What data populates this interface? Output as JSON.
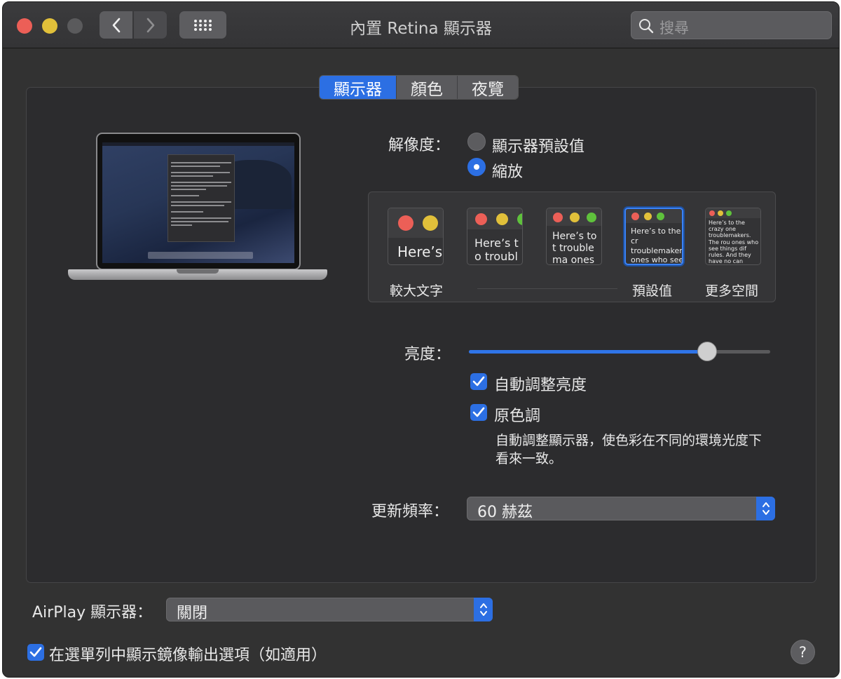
{
  "window": {
    "title": "內置 Retina 顯示器",
    "search_placeholder": "搜尋"
  },
  "tabs": [
    {
      "label": "顯示器",
      "active": true
    },
    {
      "label": "顏色",
      "active": false
    },
    {
      "label": "夜覽",
      "active": false
    }
  ],
  "resolution": {
    "label": "解像度：",
    "options": [
      {
        "label": "顯示器預設值",
        "selected": false
      },
      {
        "label": "縮放",
        "selected": true
      }
    ],
    "scales": [
      {
        "preview_text": "Here’s",
        "label": "較大文字"
      },
      {
        "preview_text": "Here’s to troublem",
        "label": ""
      },
      {
        "preview_text": "Here’s to t troublema ones who",
        "label": ""
      },
      {
        "preview_text": "Here’s to the cr troublemakers. ones who see t rules. And they",
        "label": "預設值",
        "selected": true
      },
      {
        "preview_text": "Here’s to the crazy one troublemakers. The rou ones who see things dif rules. And they have no can quote them, disagn them. About the only th Because they change th",
        "label": "更多空間"
      }
    ]
  },
  "brightness": {
    "label": "亮度：",
    "value": 0.79
  },
  "auto_brightness": {
    "label": "自動調整亮度",
    "checked": true
  },
  "true_tone": {
    "label": "原色調",
    "checked": true,
    "description_line1": "自動調整顯示器，使色彩在不同的環境光度下",
    "description_line2": "看來一致。"
  },
  "refresh_rate": {
    "label": "更新頻率：",
    "value": "60 赫茲"
  },
  "airplay": {
    "label": "AirPlay 顯示器：",
    "value": "關閉"
  },
  "mirroring_option": {
    "label": "在選單列中顯示鏡像輸出選項（如適用）",
    "checked": true
  },
  "help": {
    "label": "?"
  },
  "colors": {
    "accent": "#2c6fe3",
    "window_bg": "#323232",
    "close": "#ec5f57",
    "minimize": "#e1c03a"
  },
  "icons": {
    "back": "chevron-left-icon",
    "forward": "chevron-right-icon",
    "grid": "grid-icon",
    "search": "search-icon"
  }
}
